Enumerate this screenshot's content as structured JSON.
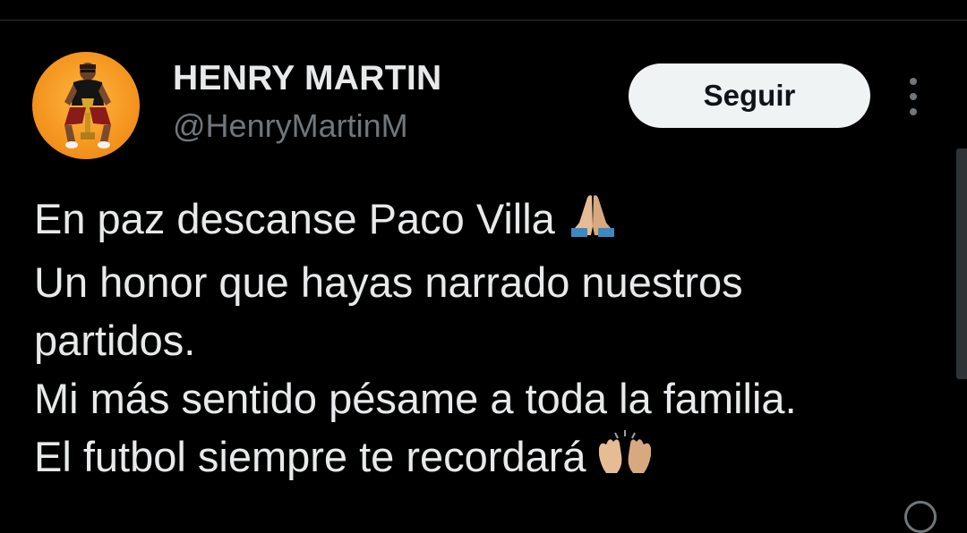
{
  "account": {
    "display_name": "HENRY MARTIN",
    "handle": "@HenryMartinM",
    "avatar_icon": "profile-photo-avatar"
  },
  "actions": {
    "follow_label": "Seguir",
    "more_icon": "more-options-vertical-dots-icon"
  },
  "tweet": {
    "lines": [
      "En paz descanse Paco Villa",
      "Un honor que hayas narrado nuestros",
      "partidos.",
      "Mi más sentido pésame a toda la familia.",
      "El futbol siempre te recordará"
    ],
    "emojis": {
      "line_1": "folded-hands-emoji",
      "line_5": "raising-hands-emoji"
    }
  },
  "colors": {
    "background": "#000000",
    "primary_text": "#e7e9ea",
    "secondary_text": "#71767b",
    "follow_button_bg": "#eff3f4",
    "follow_button_text": "#0f1419"
  }
}
